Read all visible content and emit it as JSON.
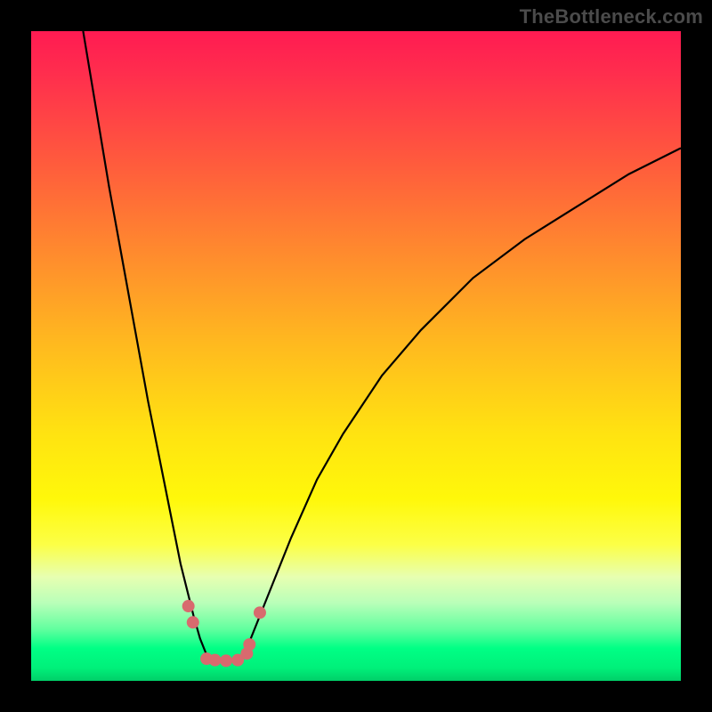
{
  "watermark": "TheBottleneck.com",
  "colors": {
    "frame": "#000000",
    "curve": "#000000",
    "marker": "#d86a6e",
    "gradient_top": "#ff1b52",
    "gradient_bottom": "#00cf68"
  },
  "chart_data": {
    "type": "line",
    "title": "",
    "xlabel": "",
    "ylabel": "",
    "xlim": [
      0,
      100
    ],
    "ylim": [
      0,
      100
    ],
    "grid": false,
    "legend": false,
    "note": "Axes unlabeled; values estimated from pixel positions. y is the vertical distance from the bottom (0 at green band, 100 at top).",
    "series": [
      {
        "name": "left-curve",
        "x": [
          8,
          10,
          12,
          14,
          16,
          18,
          20,
          21,
          22,
          23,
          24,
          25,
          26,
          27,
          28
        ],
        "y": [
          100,
          88,
          76,
          65,
          54,
          43,
          33,
          28,
          23,
          18,
          14,
          10,
          6.5,
          4,
          3
        ]
      },
      {
        "name": "right-curve",
        "x": [
          32,
          33,
          34,
          36,
          38,
          40,
          44,
          48,
          54,
          60,
          68,
          76,
          84,
          92,
          100
        ],
        "y": [
          3,
          4.5,
          7,
          12,
          17,
          22,
          31,
          38,
          47,
          54,
          62,
          68,
          73,
          78,
          82
        ]
      },
      {
        "name": "valley-floor",
        "x": [
          28,
          29,
          30,
          31,
          32
        ],
        "y": [
          3,
          3,
          3,
          3,
          3
        ]
      }
    ],
    "markers": {
      "name": "highlight-dots",
      "x": [
        24.2,
        24.9,
        27.0,
        28.3,
        30.0,
        31.8,
        33.2,
        33.6,
        35.2
      ],
      "y": [
        11.5,
        9.0,
        3.4,
        3.2,
        3.1,
        3.2,
        4.2,
        5.6,
        10.5
      ]
    }
  }
}
